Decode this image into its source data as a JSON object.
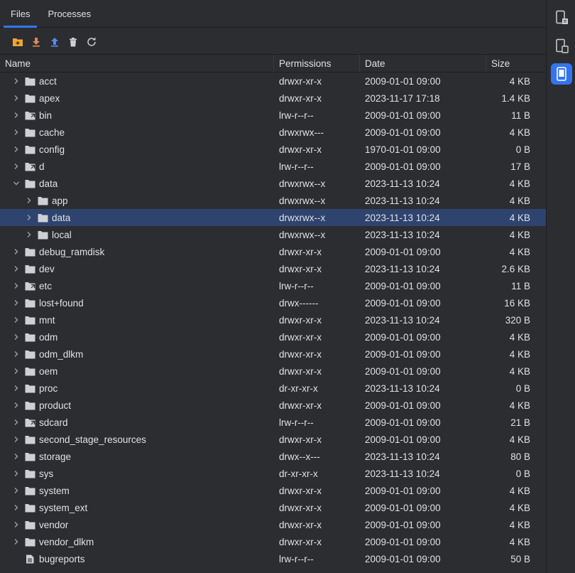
{
  "tabs": [
    {
      "label": "Files",
      "active": true
    },
    {
      "label": "Processes",
      "active": false
    }
  ],
  "toolbar": [
    {
      "icon": "new-folder-icon"
    },
    {
      "icon": "download-icon"
    },
    {
      "icon": "upload-icon"
    },
    {
      "icon": "delete-icon"
    },
    {
      "icon": "refresh-icon"
    }
  ],
  "columns": {
    "name": "Name",
    "permissions": "Permissions",
    "date": "Date",
    "size": "Size"
  },
  "colors": {
    "folder": "#ced0d6",
    "accent": "#3574f0",
    "selection": "#2e436e",
    "download": "#e08855",
    "upload": "#548af7",
    "new_folder": "#f0a732"
  },
  "rows": [
    {
      "name": "acct",
      "type": "folder",
      "depth": 0,
      "expanded": false,
      "permissions": "drwxr-xr-x",
      "date": "2009-01-01 09:00",
      "size": "4 KB"
    },
    {
      "name": "apex",
      "type": "folder",
      "depth": 0,
      "expanded": false,
      "permissions": "drwxr-xr-x",
      "date": "2023-11-17 17:18",
      "size": "1.4 KB"
    },
    {
      "name": "bin",
      "type": "link-folder",
      "depth": 0,
      "expanded": false,
      "permissions": "lrw-r--r--",
      "date": "2009-01-01 09:00",
      "size": "11 B"
    },
    {
      "name": "cache",
      "type": "folder",
      "depth": 0,
      "expanded": false,
      "permissions": "drwxrwx---",
      "date": "2009-01-01 09:00",
      "size": "4 KB"
    },
    {
      "name": "config",
      "type": "folder",
      "depth": 0,
      "expanded": false,
      "permissions": "drwxr-xr-x",
      "date": "1970-01-01 09:00",
      "size": "0 B"
    },
    {
      "name": "d",
      "type": "link-folder",
      "depth": 0,
      "expanded": false,
      "permissions": "lrw-r--r--",
      "date": "2009-01-01 09:00",
      "size": "17 B"
    },
    {
      "name": "data",
      "type": "folder",
      "depth": 0,
      "expanded": true,
      "permissions": "drwxrwx--x",
      "date": "2023-11-13 10:24",
      "size": "4 KB"
    },
    {
      "name": "app",
      "type": "folder",
      "depth": 1,
      "expanded": false,
      "permissions": "drwxrwx--x",
      "date": "2023-11-13 10:24",
      "size": "4 KB"
    },
    {
      "name": "data",
      "type": "folder",
      "depth": 1,
      "expanded": false,
      "selected": true,
      "permissions": "drwxrwx--x",
      "date": "2023-11-13 10:24",
      "size": "4 KB"
    },
    {
      "name": "local",
      "type": "folder",
      "depth": 1,
      "expanded": false,
      "permissions": "drwxrwx--x",
      "date": "2023-11-13 10:24",
      "size": "4 KB"
    },
    {
      "name": "debug_ramdisk",
      "type": "folder",
      "depth": 0,
      "expanded": false,
      "permissions": "drwxr-xr-x",
      "date": "2009-01-01 09:00",
      "size": "4 KB"
    },
    {
      "name": "dev",
      "type": "folder",
      "depth": 0,
      "expanded": false,
      "permissions": "drwxr-xr-x",
      "date": "2023-11-13 10:24",
      "size": "2.6 KB"
    },
    {
      "name": "etc",
      "type": "link-folder",
      "depth": 0,
      "expanded": false,
      "permissions": "lrw-r--r--",
      "date": "2009-01-01 09:00",
      "size": "11 B"
    },
    {
      "name": "lost+found",
      "type": "folder",
      "depth": 0,
      "expanded": false,
      "permissions": "drwx------",
      "date": "2009-01-01 09:00",
      "size": "16 KB"
    },
    {
      "name": "mnt",
      "type": "folder",
      "depth": 0,
      "expanded": false,
      "permissions": "drwxr-xr-x",
      "date": "2023-11-13 10:24",
      "size": "320 B"
    },
    {
      "name": "odm",
      "type": "folder",
      "depth": 0,
      "expanded": false,
      "permissions": "drwxr-xr-x",
      "date": "2009-01-01 09:00",
      "size": "4 KB"
    },
    {
      "name": "odm_dlkm",
      "type": "folder",
      "depth": 0,
      "expanded": false,
      "permissions": "drwxr-xr-x",
      "date": "2009-01-01 09:00",
      "size": "4 KB"
    },
    {
      "name": "oem",
      "type": "folder",
      "depth": 0,
      "expanded": false,
      "permissions": "drwxr-xr-x",
      "date": "2009-01-01 09:00",
      "size": "4 KB"
    },
    {
      "name": "proc",
      "type": "folder",
      "depth": 0,
      "expanded": false,
      "permissions": "dr-xr-xr-x",
      "date": "2023-11-13 10:24",
      "size": "0 B"
    },
    {
      "name": "product",
      "type": "folder",
      "depth": 0,
      "expanded": false,
      "permissions": "drwxr-xr-x",
      "date": "2009-01-01 09:00",
      "size": "4 KB"
    },
    {
      "name": "sdcard",
      "type": "link-folder",
      "depth": 0,
      "expanded": false,
      "permissions": "lrw-r--r--",
      "date": "2009-01-01 09:00",
      "size": "21 B"
    },
    {
      "name": "second_stage_resources",
      "type": "folder",
      "depth": 0,
      "expanded": false,
      "permissions": "drwxr-xr-x",
      "date": "2009-01-01 09:00",
      "size": "4 KB"
    },
    {
      "name": "storage",
      "type": "folder",
      "depth": 0,
      "expanded": false,
      "permissions": "drwx--x---",
      "date": "2023-11-13 10:24",
      "size": "80 B"
    },
    {
      "name": "sys",
      "type": "folder",
      "depth": 0,
      "expanded": false,
      "permissions": "dr-xr-xr-x",
      "date": "2023-11-13 10:24",
      "size": "0 B"
    },
    {
      "name": "system",
      "type": "folder",
      "depth": 0,
      "expanded": false,
      "permissions": "drwxr-xr-x",
      "date": "2009-01-01 09:00",
      "size": "4 KB"
    },
    {
      "name": "system_ext",
      "type": "folder",
      "depth": 0,
      "expanded": false,
      "permissions": "drwxr-xr-x",
      "date": "2009-01-01 09:00",
      "size": "4 KB"
    },
    {
      "name": "vendor",
      "type": "folder",
      "depth": 0,
      "expanded": false,
      "permissions": "drwxr-xr-x",
      "date": "2009-01-01 09:00",
      "size": "4 KB"
    },
    {
      "name": "vendor_dlkm",
      "type": "folder",
      "depth": 0,
      "expanded": false,
      "permissions": "drwxr-xr-x",
      "date": "2009-01-01 09:00",
      "size": "4 KB"
    },
    {
      "name": "bugreports",
      "type": "file-link",
      "depth": 0,
      "expanded": false,
      "permissions": "lrw-r--r--",
      "date": "2009-01-01 09:00",
      "size": "50 B"
    }
  ],
  "sidebar": [
    {
      "icon": "device-explorer-icon",
      "active": false
    },
    {
      "icon": "device-manager-icon",
      "active": false
    },
    {
      "icon": "running-device-icon",
      "active": true
    }
  ]
}
